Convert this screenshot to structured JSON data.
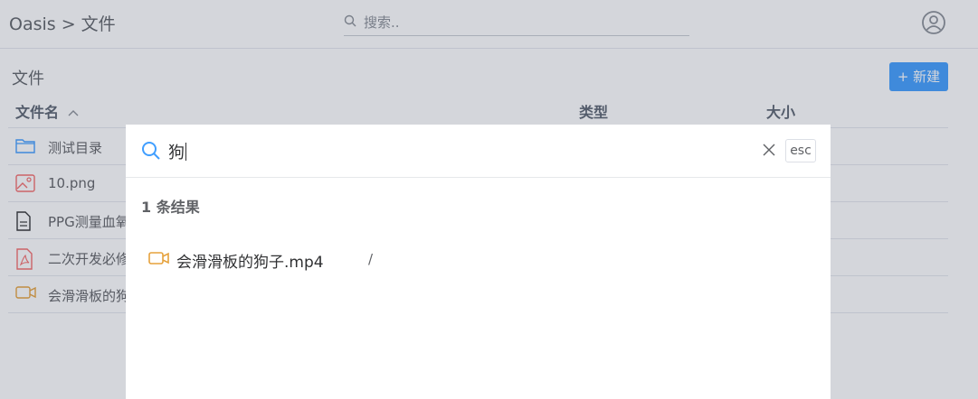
{
  "header": {
    "app_name": "Oasis",
    "separator": ">",
    "current": "文件",
    "search_placeholder": "搜索.."
  },
  "main": {
    "section_title": "文件",
    "new_button_label": "+ 新建",
    "columns": {
      "name": "文件名",
      "type": "类型",
      "size": "大小"
    },
    "files": [
      {
        "name": "测试目录",
        "icon": "folder-icon"
      },
      {
        "name": "10.png",
        "icon": "image-icon"
      },
      {
        "name": "PPG测量血氧",
        "icon": "document-icon"
      },
      {
        "name": "二次开发必修",
        "icon": "pdf-icon"
      },
      {
        "name": "会滑滑板的狗子",
        "icon": "video-icon"
      }
    ]
  },
  "search_dialog": {
    "query": "狗",
    "esc_label": "esc",
    "result_count_text": "1 条结果",
    "results": [
      {
        "name": "会滑滑板的狗子.mp4",
        "path": "/",
        "icon": "video-icon"
      }
    ]
  },
  "colors": {
    "accent": "#409eff",
    "folder": "#409eff",
    "image": "#f56c6c",
    "video": "#e6a23c"
  }
}
